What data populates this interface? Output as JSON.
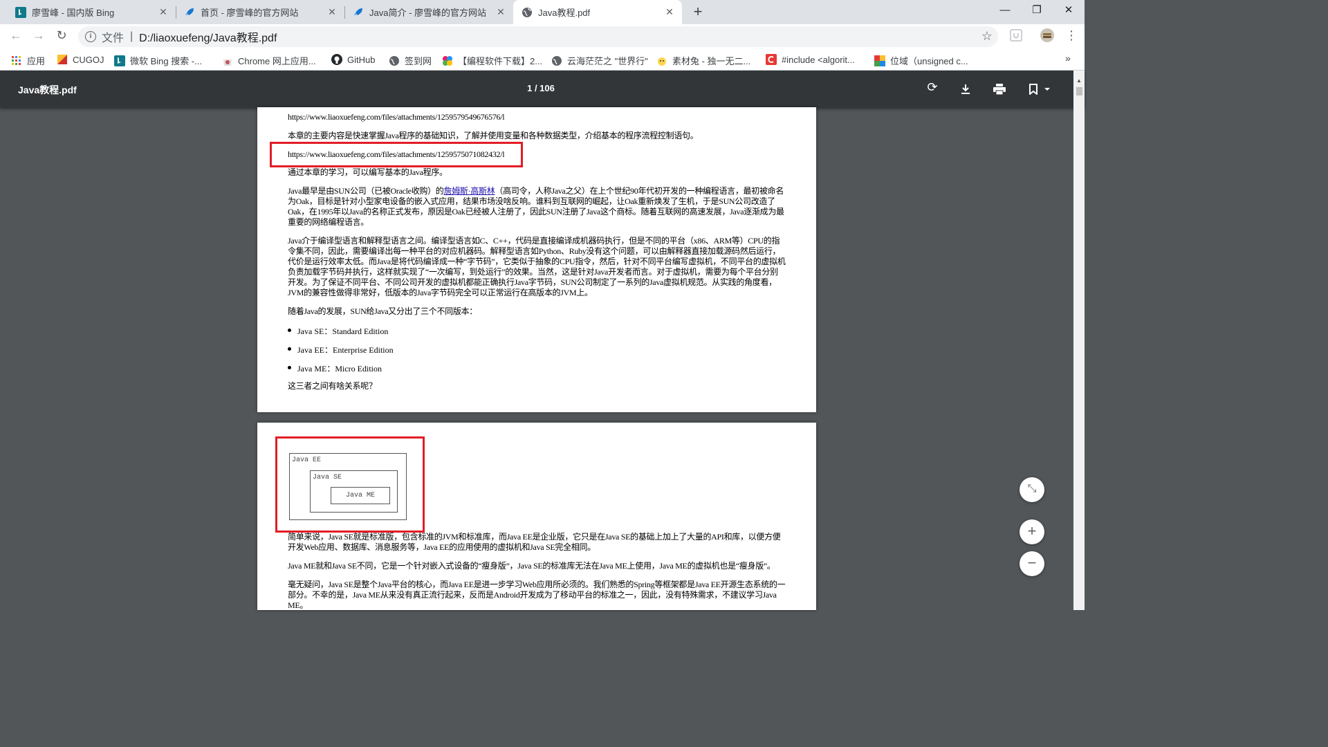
{
  "tabs": [
    {
      "title": "廖雪峰 - 国内版 Bing",
      "icon": "bing-icon"
    },
    {
      "title": "首页 - 廖雪峰的官方网站",
      "icon": "rocket-icon"
    },
    {
      "title": "Java简介 - 廖雪峰的官方网站",
      "icon": "rocket-icon"
    },
    {
      "title": "Java教程.pdf",
      "icon": "globe-icon"
    }
  ],
  "omnibox": {
    "label": "文件",
    "url": "D:/liaoxuefeng/Java教程.pdf"
  },
  "bookmarks": [
    {
      "label": "应用"
    },
    {
      "label": "CUGOJ"
    },
    {
      "label": "微软 Bing 搜索 -..."
    },
    {
      "label": "Chrome 网上应用..."
    },
    {
      "label": "GitHub"
    },
    {
      "label": "签到网"
    },
    {
      "label": "【编程软件下载】2..."
    },
    {
      "label": "云海茫茫之 \"世界行\""
    },
    {
      "label": "素材兔 - 独一无二..."
    },
    {
      "label": "#include <algorit..."
    },
    {
      "label": "位域（unsigned c..."
    }
  ],
  "pdf": {
    "title": "Java教程.pdf",
    "page_indicator": "1 / 106"
  },
  "page1": {
    "url1": "https://www.liaoxuefeng.com/files/attachments/1259579549676576/l",
    "intro": "本章的主要内容是快速掌握Java程序的基础知识，了解并使用变量和各种数据类型，介绍基本的程序流程控制语句。",
    "url2": "https://www.liaoxuefeng.com/files/attachments/1259575071082432/l",
    "goal": "通过本章的学习，可以编写基本的Java程序。",
    "p1_a": "Java最早是由SUN公司（已被Oracle收购）的",
    "p1_link": "詹姆斯·高斯林",
    "p1_b": "（高司令，人称Java之父）在上个世纪90年代初开发的一种编程语言，最初被命名为Oak，目标是针对小型家电设备的嵌入式应用，结果市场没啥反响。谁料到互联网的崛起，让Oak重新焕发了生机，于是SUN公司改造了Oak，在1995年以Java的名称正式发布，原因是Oak已经被人注册了，因此SUN注册了Java这个商标。随着互联网的高速发展，Java逐渐成为最重要的网络编程语言。",
    "p2": "Java介于编译型语言和解释型语言之间。编译型语言如C、C++，代码是直接编译成机器码执行，但是不同的平台（x86、ARM等）CPU的指令集不同，因此，需要编译出每一种平台的对应机器码。解释型语言如Python、Ruby没有这个问题，可以由解释器直接加载源码然后运行，代价是运行效率太低。而Java是将代码编译成一种“字节码”，它类似于抽象的CPU指令，然后，针对不同平台编写虚拟机，不同平台的虚拟机负责加载字节码并执行，这样就实现了“一次编写，到处运行”的效果。当然，这是针对Java开发者而言。对于虚拟机，需要为每个平台分别开发。为了保证不同平台、不同公司开发的虚拟机都能正确执行Java字节码，SUN公司制定了一系列的Java虚拟机规范。从实践的角度看，JVM的兼容性做得非常好，低版本的Java字节码完全可以正常运行在高版本的JVM上。",
    "p3": "随着Java的发展，SUN给Java又分出了三个不同版本：",
    "bullets": [
      "Java SE：Standard Edition",
      "Java EE：Enterprise Edition",
      "Java ME：Micro Edition"
    ],
    "question": "这三者之间有啥关系呢？"
  },
  "page2": {
    "diagram": {
      "outer": "Java EE",
      "middle": "Java SE",
      "inner": "Java ME"
    },
    "p1": "简单来说，Java SE就是标准版，包含标准的JVM和标准库，而Java EE是企业版，它只是在Java SE的基础上加上了大量的API和库，以便方便开发Web应用、数据库、消息服务等，Java EE的应用使用的虚拟机和Java SE完全相同。",
    "p2": "Java ME就和Java SE不同，它是一个针对嵌入式设备的“瘦身版”，Java SE的标准库无法在Java ME上使用，Java ME的虚拟机也是“瘦身版”。",
    "p3": "毫无疑问，Java SE是整个Java平台的核心，而Java EE是进一步学习Web应用所必须的。我们熟悉的Spring等框架都是Java EE开源生态系统的一部分。不幸的是，Java ME从来没有真正流行起来，反而是Android开发成为了移动平台的标准之一，因此，没有特殊需求，不建议学习Java ME。"
  }
}
